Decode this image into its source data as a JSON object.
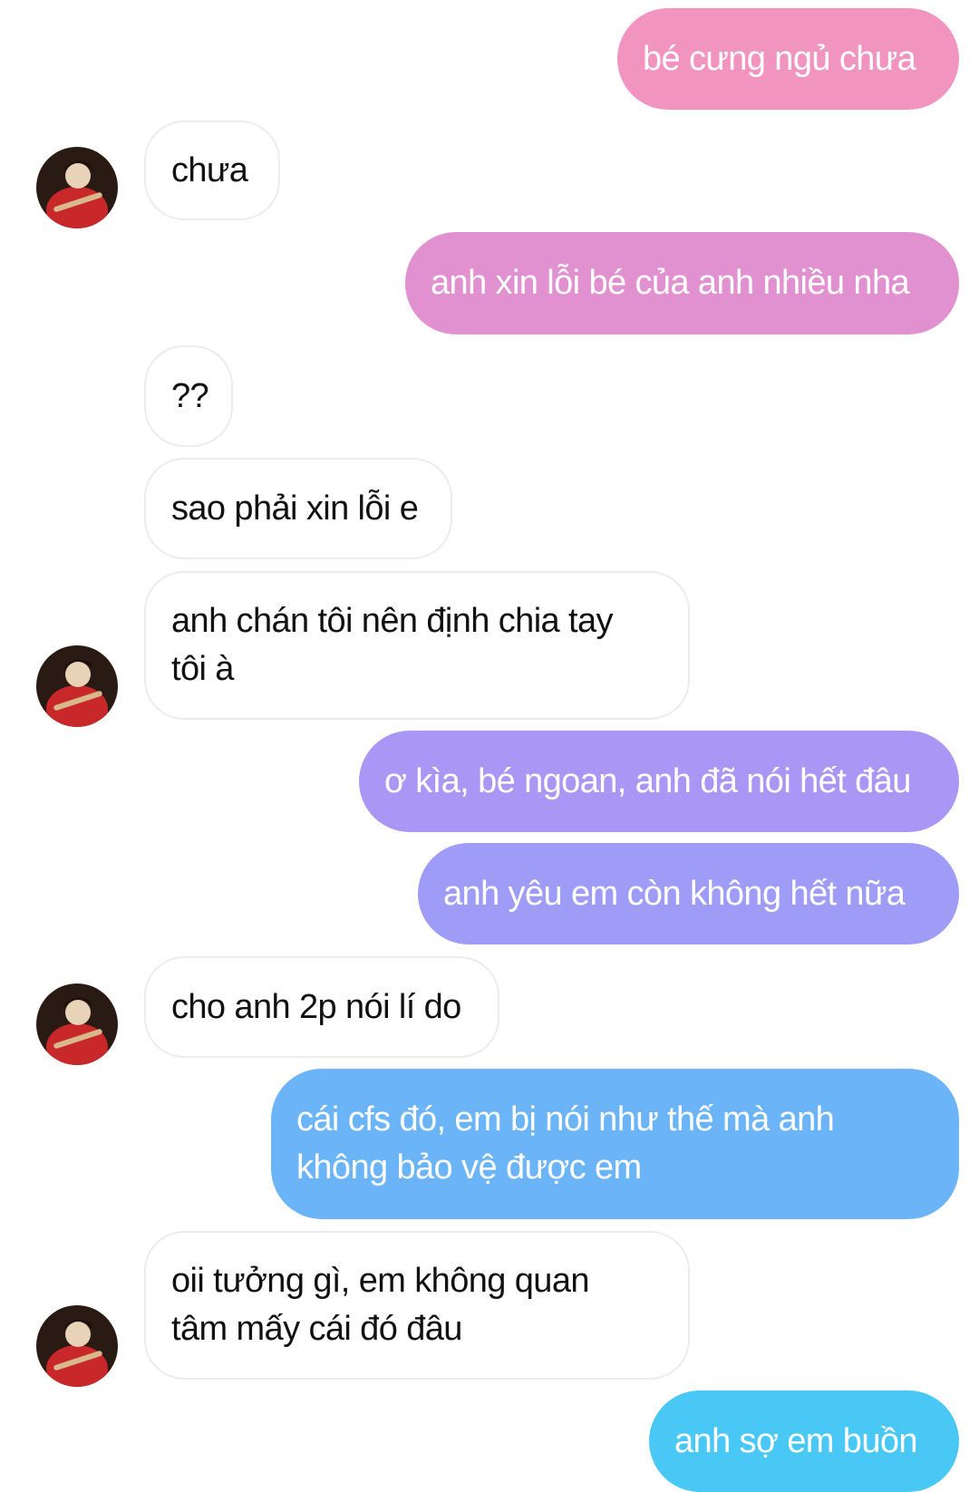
{
  "colors": {
    "incoming_bg": "#ffffff",
    "incoming_border": "#ececec",
    "incoming_text": "#111111",
    "outgoing_text": "#ffffff",
    "outgoing_bg_1": "#f294c0",
    "outgoing_bg_2": "#e191d0",
    "outgoing_bg_3": "#aa97f5",
    "outgoing_bg_4": "#9f9cf8",
    "outgoing_bg_5": "#6ab4f7",
    "outgoing_bg_6": "#49c8f5"
  },
  "avatar": {
    "icon": "contact-avatar-icon",
    "description_colors": [
      "#2a1a14",
      "#c8282a",
      "#e8d2b8"
    ]
  },
  "messages": [
    {
      "from": "me",
      "text": "bé cưng ngủ chưa"
    },
    {
      "from": "them",
      "text": "chưa"
    },
    {
      "from": "me",
      "text": "anh xin lỗi bé của anh nhiều nha"
    },
    {
      "from": "them",
      "text": "??"
    },
    {
      "from": "them",
      "text": "sao phải xin lỗi e"
    },
    {
      "from": "them",
      "lines": [
        "anh chán tôi nên định chia tay",
        "tôi à"
      ]
    },
    {
      "from": "me",
      "text": "ơ kìa, bé ngoan, anh đã nói hết đâu"
    },
    {
      "from": "me",
      "text": "anh yêu em còn không hết nữa"
    },
    {
      "from": "them",
      "text": "cho anh 2p nói lí do"
    },
    {
      "from": "me",
      "lines": [
        "cái cfs đó, em bị nói như thế mà  anh",
        "không bảo vệ được em"
      ]
    },
    {
      "from": "them",
      "lines": [
        "oii tưởng gì, em không quan",
        "tâm mấy cái đó đâu"
      ]
    },
    {
      "from": "me",
      "text": "anh sợ em buồn"
    }
  ]
}
